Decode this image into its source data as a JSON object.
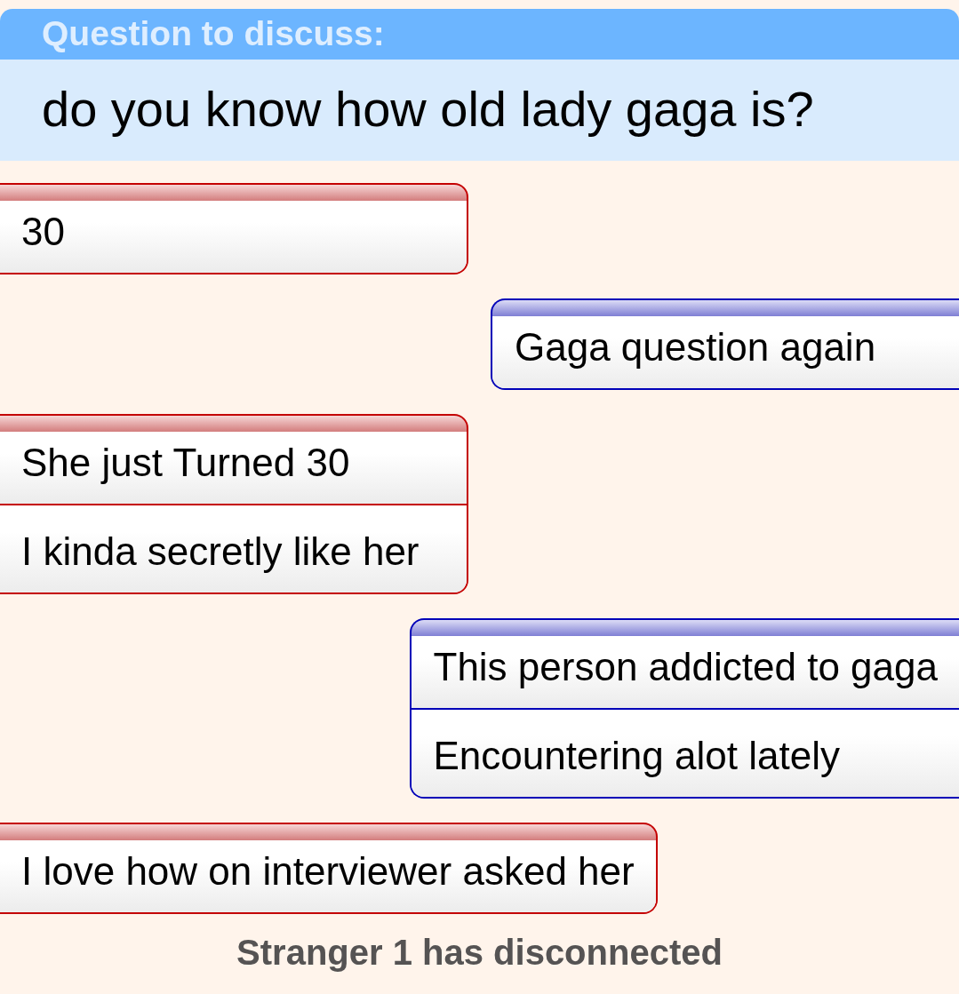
{
  "question": {
    "heading": "Question to discuss:",
    "text": "do you know how old lady gaga is?"
  },
  "messages": [
    {
      "kind": "left",
      "lines": [
        "30"
      ]
    },
    {
      "kind": "right",
      "lines": [
        "Gaga question again"
      ]
    },
    {
      "kind": "left",
      "lines": [
        "She just Turned 30",
        "I kinda secretly like her"
      ]
    },
    {
      "kind": "right",
      "lines": [
        "This person addicted to gaga",
        "Encountering alot lately"
      ]
    },
    {
      "kind": "left",
      "lines": [
        "I love how on interviewer asked her"
      ]
    }
  ],
  "status": "Stranger 1 has disconnected"
}
